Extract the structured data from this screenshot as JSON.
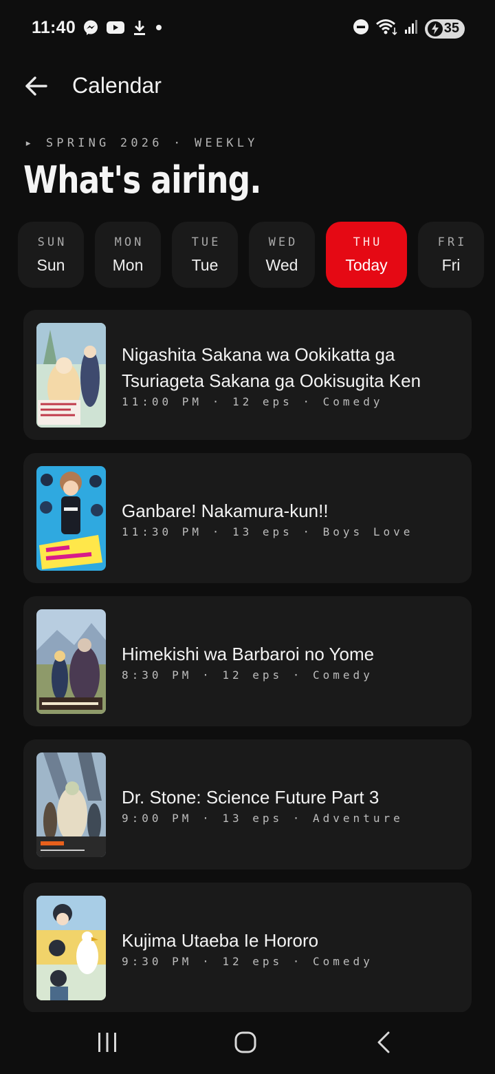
{
  "status_bar": {
    "time": "11:40",
    "left_icons": [
      "messenger-icon",
      "youtube-icon",
      "download-icon",
      "dot-icon"
    ],
    "right_icons": [
      "do-not-disturb-icon",
      "wifi-icon",
      "signal-icon",
      "battery-icon"
    ],
    "battery": "35"
  },
  "app_bar": {
    "title": "Calendar"
  },
  "header": {
    "season_line": "▸ SPRING 2026 · WEEKLY",
    "headline": "What's airing."
  },
  "accent_color": "#e50914",
  "day_tabs": [
    {
      "abbr": "SUN",
      "name": "Sun",
      "active": false
    },
    {
      "abbr": "MON",
      "name": "Mon",
      "active": false
    },
    {
      "abbr": "TUE",
      "name": "Tue",
      "active": false
    },
    {
      "abbr": "WED",
      "name": "Wed",
      "active": false
    },
    {
      "abbr": "THU",
      "name": "Today",
      "active": true
    },
    {
      "abbr": "FRI",
      "name": "Fri",
      "active": false
    }
  ],
  "shows": [
    {
      "title": "Nigashita Sakana wa Ookikatta ga Tsuriageta Sakana ga Ookisugita Ken",
      "meta": "11:00 PM · 12 eps · Comedy"
    },
    {
      "title": "Ganbare! Nakamura-kun!!",
      "meta": "11:30 PM · 13 eps · Boys Love"
    },
    {
      "title": "Himekishi wa Barbaroi no Yome",
      "meta": "8:30 PM · 12 eps · Comedy"
    },
    {
      "title": "Dr. Stone: Science Future Part 3",
      "meta": "9:00 PM · 13 eps · Adventure"
    },
    {
      "title": "Kujima Utaeba Ie Hororo",
      "meta": "9:30 PM · 12 eps · Comedy"
    }
  ],
  "nav_bar": {
    "icons": [
      "recent-apps-icon",
      "home-icon",
      "back-nav-icon"
    ]
  }
}
